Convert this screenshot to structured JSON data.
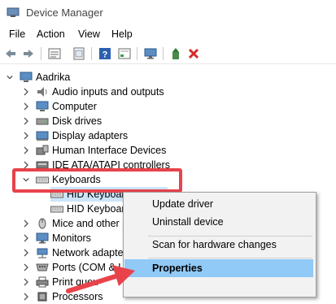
{
  "window": {
    "title": "Device Manager"
  },
  "menu": [
    "File",
    "Action",
    "View",
    "Help"
  ],
  "toolbar_icons": [
    "back-arrow-icon",
    "forward-arrow-icon",
    "properties-icon",
    "update-icon",
    "help-icon",
    "grid-icon",
    "monitor-icon",
    "add-driver-icon",
    "uninstall-x-icon"
  ],
  "tree": {
    "root": "Aadrika",
    "categories": [
      "Audio inputs and outputs",
      "Computer",
      "Disk drives",
      "Display adapters",
      "Human Interface Devices",
      "IDE ATA/ATAPI controllers",
      "Keyboards",
      "Mice and other p",
      "Monitors",
      "Network adapter",
      "Ports (COM & LI",
      "Print queu",
      "Processors"
    ],
    "keyboard_children": [
      "HID Keyboard Device",
      "HID Keyboar"
    ]
  },
  "context_menu": {
    "items": [
      "Update driver",
      "Uninstall device",
      "Scan for hardware changes",
      "Properties"
    ],
    "highlighted": "Properties"
  },
  "colors": {
    "highlight": "#cce4f7",
    "menu_highlight": "#91c9f7",
    "annotation_red": "#e8434b"
  }
}
